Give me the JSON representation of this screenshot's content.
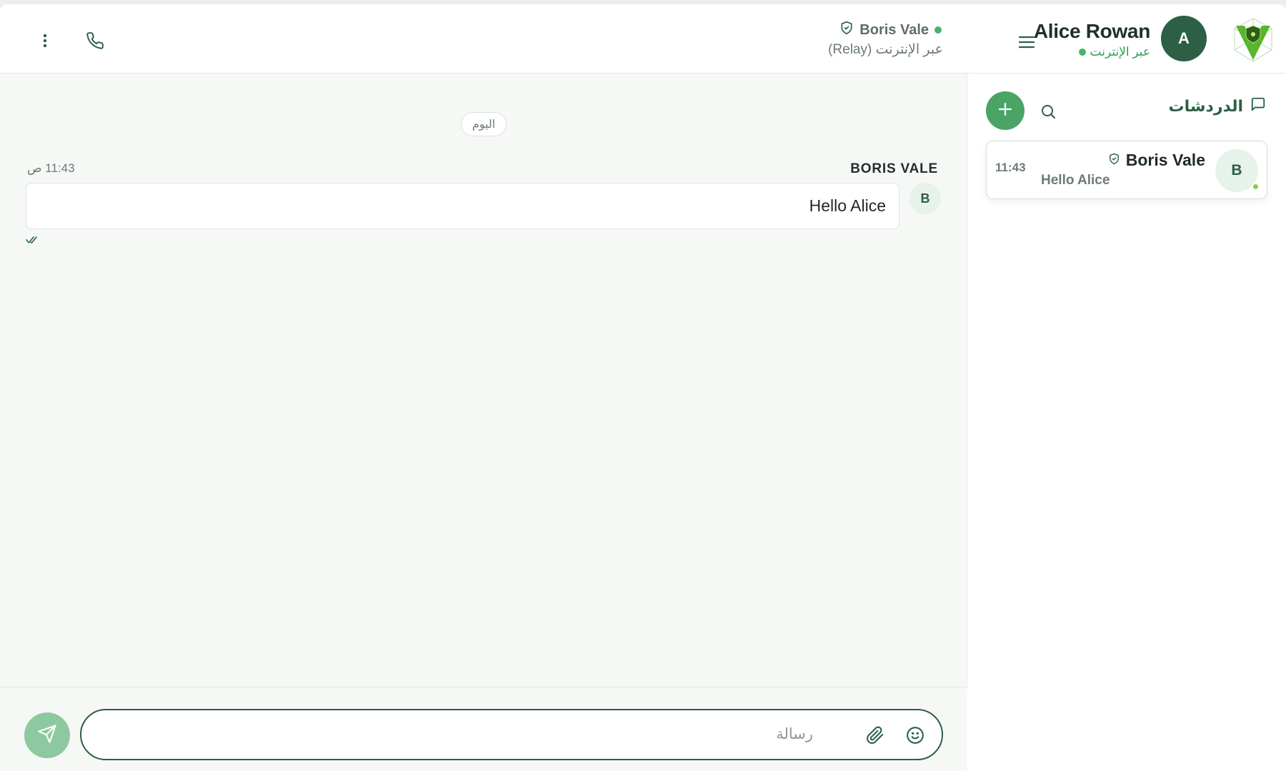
{
  "app": {
    "accent_color": "#2c5f45",
    "success_color": "#4aa466"
  },
  "profile": {
    "name": "Alice Rowan",
    "avatar_initial": "A",
    "status": "عبر الإنترنت",
    "logo_icon": "shield-v-logo-icon",
    "menu_icon": "hamburger-menu-icon"
  },
  "sidebar": {
    "title": "الدردشات",
    "title_icon": "chat-bubble-icon",
    "search_icon": "search-icon",
    "add_icon": "plus-icon",
    "chats": [
      {
        "name": "Boris Vale",
        "avatar_initial": "B",
        "preview": "Hello Alice",
        "time": "11:43",
        "verified_icon": "shield-check-icon",
        "online": true
      }
    ]
  },
  "chat_header": {
    "peer_name": "Boris Vale",
    "peer_status": "عبر الإنترنت (Relay)",
    "verified_icon": "shield-check-icon",
    "call_icon": "phone-icon",
    "more_icon": "more-vertical-icon"
  },
  "conversation": {
    "day_label": "اليوم",
    "messages": [
      {
        "sender": "BORIS VALE",
        "avatar_initial": "B",
        "text": "Hello Alice",
        "time": "11:43 ص",
        "status_icon": "double-check-icon"
      }
    ]
  },
  "composer": {
    "placeholder": "رسالة",
    "value": "",
    "emoji_icon": "smile-icon",
    "attach_icon": "paperclip-icon",
    "send_icon": "send-icon"
  }
}
